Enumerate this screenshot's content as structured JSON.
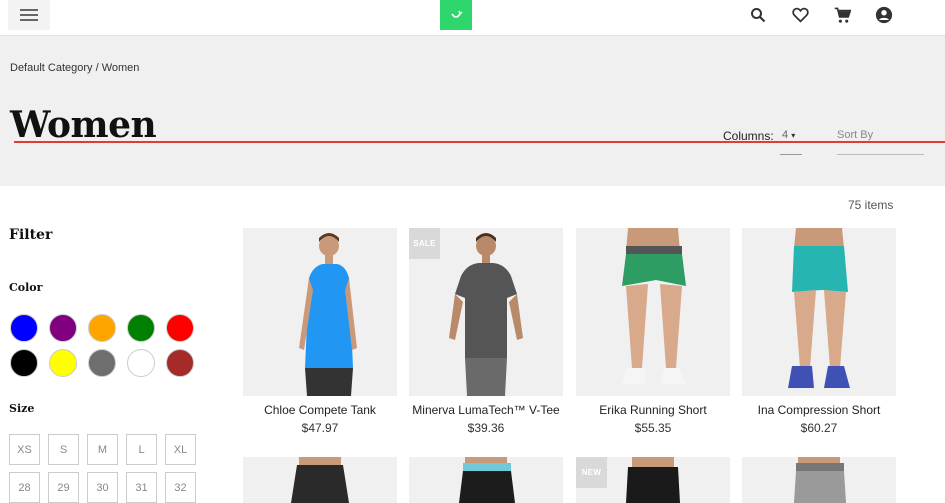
{
  "header": {
    "menu_icon": "hamburger-menu-icon",
    "logo_icon": "shopping-bag-logo-icon",
    "icons": [
      "search-icon",
      "heart-icon",
      "cart-icon",
      "account-icon"
    ]
  },
  "breadcrumb": {
    "parent": "Default Category",
    "separator": " / ",
    "current": "Women"
  },
  "page_title": "Women",
  "toolbar": {
    "columns_label": "Columns:",
    "columns_value": "4",
    "sort_placeholder": "Sort By",
    "item_count": "75 items"
  },
  "filter": {
    "title": "Filter",
    "color_title": "Color",
    "colors": [
      "#0000ff",
      "#800080",
      "#ffa500",
      "#008000",
      "#ff0000",
      "#000000",
      "#ffff00",
      "#6e6e6e",
      "#ffffff",
      "#a52a2a"
    ],
    "size_title": "Size",
    "sizes_row1": [
      "XS",
      "S",
      "M",
      "L",
      "XL"
    ],
    "sizes_row2": [
      "28",
      "29",
      "30",
      "31",
      "32"
    ]
  },
  "products": [
    {
      "name": "Chloe Compete Tank",
      "price": "$47.97",
      "badge": ""
    },
    {
      "name": "Minerva LumaTech™ V-Tee",
      "price": "$39.36",
      "badge": "SALE"
    },
    {
      "name": "Erika Running Short",
      "price": "$55.35",
      "badge": ""
    },
    {
      "name": "Ina Compression Short",
      "price": "$60.27",
      "badge": ""
    }
  ],
  "products_row2": [
    {
      "badge": ""
    },
    {
      "badge": ""
    },
    {
      "badge": "NEW"
    },
    {
      "badge": ""
    }
  ],
  "colors": {
    "accent_green": "#2fd66c",
    "rule_red": "#e53935",
    "hero_bg": "#f0f0f0"
  }
}
